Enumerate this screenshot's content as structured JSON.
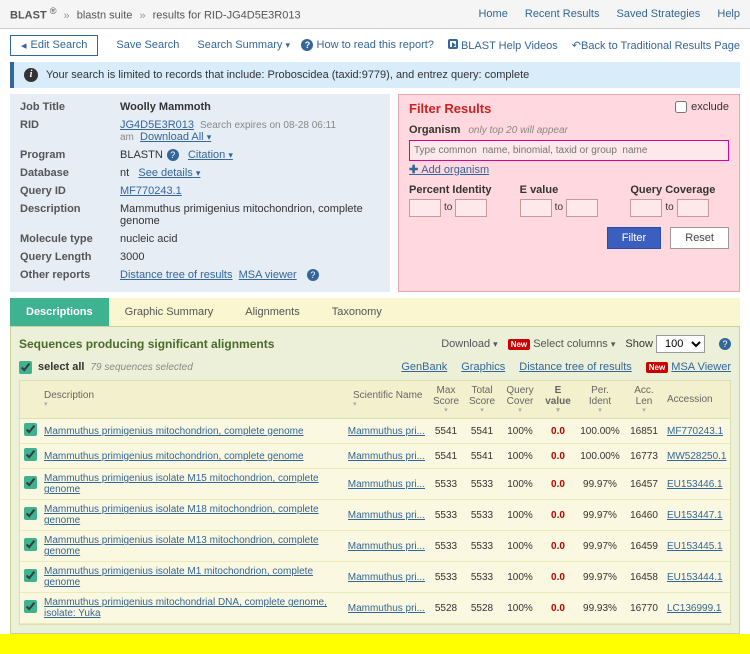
{
  "breadcrumb": {
    "app": "BLAST",
    "reg": "®",
    "sep": "»",
    "suite": "blastn suite",
    "results": "results for RID-JG4D5E3R013"
  },
  "topnav": [
    "Home",
    "Recent Results",
    "Saved Strategies",
    "Help"
  ],
  "toolbar": {
    "edit": "Edit Search",
    "save": "Save Search",
    "summary": "Search Summary",
    "how": "How to read this report?",
    "videos": "BLAST Help Videos",
    "back": "Back to Traditional Results Page"
  },
  "banner": "Your search is limited to records that include: Proboscidea (taxid:9779), and entrez query: complete",
  "meta": {
    "job_title_k": "Job Title",
    "job_title_v": "Woolly Mammoth",
    "rid_k": "RID",
    "rid_v": "JG4D5E3R013",
    "rid_exp": "Search expires on 08-28 06:11 am",
    "rid_dl": "Download All",
    "program_k": "Program",
    "program_v": "BLASTN",
    "citation": "Citation",
    "database_k": "Database",
    "database_v": "nt",
    "details": "See details",
    "queryid_k": "Query ID",
    "queryid_v": "MF770243.1",
    "desc_k": "Description",
    "desc_v": "Mammuthus primigenius mitochondrion, complete genome",
    "mol_k": "Molecule type",
    "mol_v": "nucleic acid",
    "qlen_k": "Query Length",
    "qlen_v": "3000",
    "other_k": "Other reports",
    "other_dt": "Distance tree of results",
    "other_msa": "MSA viewer"
  },
  "filter": {
    "title": "Filter Results",
    "exclude": "exclude",
    "org_label": "Organism",
    "org_hint": "only top 20 will appear",
    "org_ph": "Type common  name, binomial, taxid or group  name",
    "add_org": "Add organism",
    "pi": "Percent Identity",
    "ev": "E value",
    "qc": "Query Coverage",
    "to": "to",
    "filter_btn": "Filter",
    "reset_btn": "Reset"
  },
  "tabs": [
    "Descriptions",
    "Graphic Summary",
    "Alignments",
    "Taxonomy"
  ],
  "results": {
    "heading": "Sequences producing significant alignments",
    "download": "Download",
    "selcols": "Select columns",
    "show": "Show",
    "show_val": "100",
    "select_all": "select all",
    "count": "79 sequences selected",
    "genbank": "GenBank",
    "graphics": "Graphics",
    "dtree": "Distance tree of results",
    "msa": "MSA Viewer",
    "new": "New",
    "cols": {
      "desc": "Description",
      "sci": "Scientific Name",
      "max": "Max Score",
      "total": "Total Score",
      "cover": "Query Cover",
      "e": "E value",
      "pi": "Per. Ident",
      "len": "Acc. Len",
      "acc": "Accession"
    },
    "rows": [
      {
        "desc": "Mammuthus primigenius mitochondrion, complete genome",
        "sci": "Mammuthus pri...",
        "max": "5541",
        "total": "5541",
        "cov": "100%",
        "e": "0.0",
        "pi": "100.00%",
        "len": "16851",
        "acc": "MF770243.1"
      },
      {
        "desc": "Mammuthus primigenius mitochondrion, complete genome",
        "sci": "Mammuthus pri...",
        "max": "5541",
        "total": "5541",
        "cov": "100%",
        "e": "0.0",
        "pi": "100.00%",
        "len": "16773",
        "acc": "MW528250.1"
      },
      {
        "desc": "Mammuthus primigenius isolate M15 mitochondrion, complete genome",
        "sci": "Mammuthus pri...",
        "max": "5533",
        "total": "5533",
        "cov": "100%",
        "e": "0.0",
        "pi": "99.97%",
        "len": "16457",
        "acc": "EU153446.1"
      },
      {
        "desc": "Mammuthus primigenius isolate M18 mitochondrion, complete genome",
        "sci": "Mammuthus pri...",
        "max": "5533",
        "total": "5533",
        "cov": "100%",
        "e": "0.0",
        "pi": "99.97%",
        "len": "16460",
        "acc": "EU153447.1"
      },
      {
        "desc": "Mammuthus primigenius isolate M13 mitochondrion, complete genome",
        "sci": "Mammuthus pri...",
        "max": "5533",
        "total": "5533",
        "cov": "100%",
        "e": "0.0",
        "pi": "99.97%",
        "len": "16459",
        "acc": "EU153445.1"
      },
      {
        "desc": "Mammuthus primigenius isolate M1 mitochondrion, complete genome",
        "sci": "Mammuthus pri...",
        "max": "5533",
        "total": "5533",
        "cov": "100%",
        "e": "0.0",
        "pi": "99.97%",
        "len": "16458",
        "acc": "EU153444.1"
      },
      {
        "desc": "Mammuthus primigenius mitochondrial DNA, complete genome, isolate: Yuka",
        "sci": "Mammuthus pri...",
        "max": "5528",
        "total": "5528",
        "cov": "100%",
        "e": "0.0",
        "pi": "99.93%",
        "len": "16770",
        "acc": "LC136999.1"
      }
    ]
  }
}
